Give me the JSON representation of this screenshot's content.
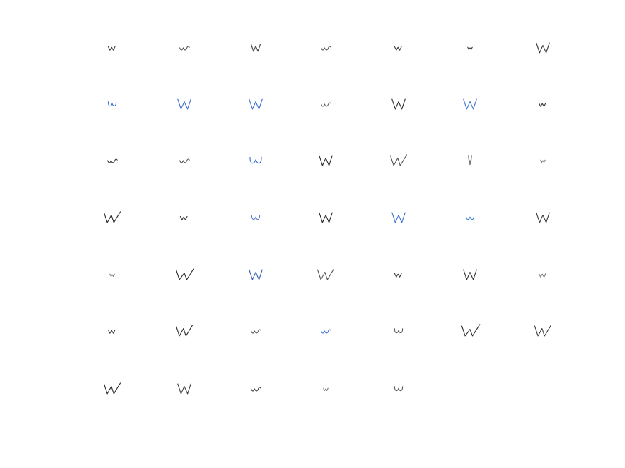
{
  "grid": {
    "columns": 7,
    "rows": 7,
    "samples": [
      {
        "letter": "w",
        "style": "small",
        "ink": "#3a3a3a"
      },
      {
        "letter": "w",
        "style": "cursive",
        "ink": "#4a4a4a"
      },
      {
        "letter": "w",
        "style": "print",
        "ink": "#3a3a3a"
      },
      {
        "letter": "w",
        "style": "cursive",
        "ink": "#555555"
      },
      {
        "letter": "w",
        "style": "small",
        "ink": "#3a3a3a"
      },
      {
        "letter": "w",
        "style": "tiny",
        "ink": "#3a3a3a"
      },
      {
        "letter": "W",
        "style": "print",
        "ink": "#333333"
      },
      {
        "letter": "w",
        "style": "round",
        "ink": "#3b6fd1"
      },
      {
        "letter": "W",
        "style": "print",
        "ink": "#3b6fd1"
      },
      {
        "letter": "W",
        "style": "print",
        "ink": "#3b6fd1"
      },
      {
        "letter": "w",
        "style": "cursive",
        "ink": "#666666"
      },
      {
        "letter": "W",
        "style": "print",
        "ink": "#2a2a2a"
      },
      {
        "letter": "W",
        "style": "print",
        "ink": "#3b6fd1"
      },
      {
        "letter": "w",
        "style": "small",
        "ink": "#3a3a3a"
      },
      {
        "letter": "w",
        "style": "cursive",
        "ink": "#3a3a3a"
      },
      {
        "letter": "w",
        "style": "cursive",
        "ink": "#555555"
      },
      {
        "letter": "W",
        "style": "round",
        "ink": "#3b6fd1"
      },
      {
        "letter": "W",
        "style": "print",
        "ink": "#2a2a2a"
      },
      {
        "letter": "W",
        "style": "slanted",
        "ink": "#555555"
      },
      {
        "letter": "w",
        "style": "tall",
        "ink": "#777777"
      },
      {
        "letter": "w",
        "style": "tiny",
        "ink": "#777777"
      },
      {
        "letter": "W",
        "style": "slanted",
        "ink": "#2a2a2a"
      },
      {
        "letter": "w",
        "style": "small",
        "ink": "#3a3a3a"
      },
      {
        "letter": "w",
        "style": "round",
        "ink": "#5a7fd1"
      },
      {
        "letter": "W",
        "style": "print",
        "ink": "#2a2a2a"
      },
      {
        "letter": "W",
        "style": "print",
        "ink": "#3b6fd1"
      },
      {
        "letter": "w",
        "style": "round",
        "ink": "#3b7fd1"
      },
      {
        "letter": "W",
        "style": "print",
        "ink": "#3a3a3a"
      },
      {
        "letter": "w",
        "style": "tiny",
        "ink": "#777777"
      },
      {
        "letter": "W",
        "style": "sweep",
        "ink": "#2a2a2a"
      },
      {
        "letter": "W",
        "style": "print",
        "ink": "#2f5fb0"
      },
      {
        "letter": "W",
        "style": "slanted",
        "ink": "#555555"
      },
      {
        "letter": "w",
        "style": "small",
        "ink": "#3a3a3a"
      },
      {
        "letter": "W",
        "style": "print",
        "ink": "#2a2a2a"
      },
      {
        "letter": "w",
        "style": "small",
        "ink": "#777777"
      },
      {
        "letter": "w",
        "style": "small",
        "ink": "#3a3a3a"
      },
      {
        "letter": "W",
        "style": "slanted",
        "ink": "#2a2a2a"
      },
      {
        "letter": "w",
        "style": "cursive",
        "ink": "#555555"
      },
      {
        "letter": "w",
        "style": "cursive",
        "ink": "#3b6fd1"
      },
      {
        "letter": "w",
        "style": "round",
        "ink": "#555555"
      },
      {
        "letter": "W",
        "style": "sweep",
        "ink": "#2a2a2a"
      },
      {
        "letter": "W",
        "style": "slanted",
        "ink": "#3a3a3a"
      },
      {
        "letter": "W",
        "style": "slanted",
        "ink": "#2a2a2a"
      },
      {
        "letter": "W",
        "style": "print",
        "ink": "#3a3a3a"
      },
      {
        "letter": "w",
        "style": "cursive",
        "ink": "#3a3a3a"
      },
      {
        "letter": "w",
        "style": "tiny",
        "ink": "#777777"
      },
      {
        "letter": "w",
        "style": "round",
        "ink": "#555555"
      }
    ]
  }
}
